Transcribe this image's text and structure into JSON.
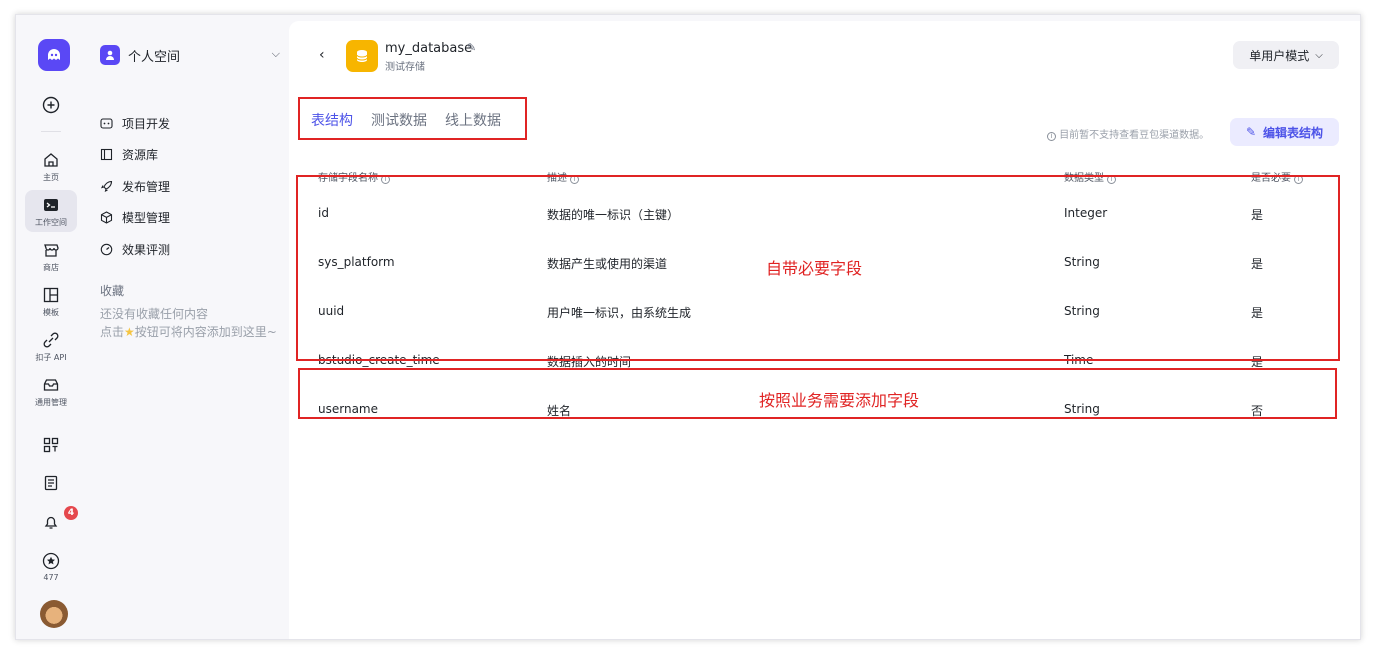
{
  "rail": {
    "items": [
      {
        "label": "主页",
        "icon": "home-icon"
      },
      {
        "label": "工作空间",
        "icon": "workspace-icon"
      },
      {
        "label": "商店",
        "icon": "store-icon"
      },
      {
        "label": "模板",
        "icon": "template-icon"
      },
      {
        "label": "扣子 API",
        "icon": "api-icon"
      },
      {
        "label": "通用管理",
        "icon": "management-icon"
      }
    ],
    "star_count": "477",
    "notification_count": "4"
  },
  "sidebar": {
    "space_title": "个人空间",
    "nav": [
      {
        "label": "项目开发",
        "icon": "project-icon"
      },
      {
        "label": "资源库",
        "icon": "library-icon"
      },
      {
        "label": "发布管理",
        "icon": "rocket-icon"
      },
      {
        "label": "模型管理",
        "icon": "cube-icon"
      },
      {
        "label": "效果评测",
        "icon": "gauge-icon"
      }
    ],
    "favorites_title": "收藏",
    "favorites_empty_1": "还没有收藏任何内容",
    "favorites_empty_2a": "点击",
    "favorites_empty_2b": "按钮可将内容添加到这里~"
  },
  "header": {
    "db_name": "my_database",
    "db_subtitle": "测试存储",
    "mode_label": "单用户模式"
  },
  "tabs": [
    {
      "label": "表结构",
      "active": true
    },
    {
      "label": "测试数据",
      "active": false
    },
    {
      "label": "线上数据",
      "active": false
    }
  ],
  "notice": "目前暂不支持查看豆包渠道数据。",
  "edit_button": "编辑表结构",
  "table": {
    "headers": [
      "存储字段名称",
      "描述",
      "数据类型",
      "是否必要"
    ],
    "rows": [
      {
        "name": "id",
        "desc": "数据的唯一标识（主键）",
        "type": "Integer",
        "required": "是"
      },
      {
        "name": "sys_platform",
        "desc": "数据产生或使用的渠道",
        "type": "String",
        "required": "是"
      },
      {
        "name": "uuid",
        "desc": "用户唯一标识，由系统生成",
        "type": "String",
        "required": "是"
      },
      {
        "name": "bstudio_create_time",
        "desc": "数据插入的时间",
        "type": "Time",
        "required": "是"
      },
      {
        "name": "username",
        "desc": "姓名",
        "type": "String",
        "required": "否"
      }
    ]
  },
  "annotations": {
    "builtin": "自带必要字段",
    "custom": "按照业务需要添加字段"
  },
  "colors": {
    "brand": "#5a48f5",
    "accent": "#4d53e8",
    "annotation_red": "#e02424",
    "db_icon": "#f7b500"
  }
}
